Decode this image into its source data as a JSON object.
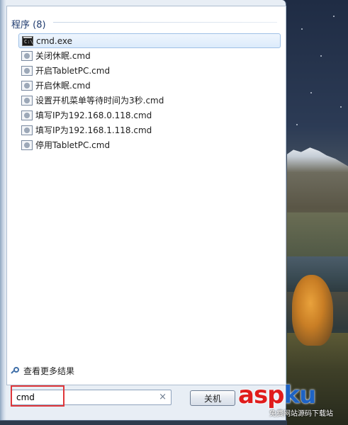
{
  "programs": {
    "header": "程序 (8)",
    "items": [
      {
        "label": "cmd.exe",
        "icon": "cmd-icon",
        "selected": true
      },
      {
        "label": "关闭休眠.cmd",
        "icon": "batch-file-icon"
      },
      {
        "label": "开启TabletPC.cmd",
        "icon": "batch-file-icon"
      },
      {
        "label": "开启休眠.cmd",
        "icon": "batch-file-icon"
      },
      {
        "label": "设置开机菜单等待时间为3秒.cmd",
        "icon": "batch-file-icon"
      },
      {
        "label": "填写IP为192.168.0.118.cmd",
        "icon": "batch-file-icon"
      },
      {
        "label": "填写IP为192.168.1.118.cmd",
        "icon": "batch-file-icon"
      },
      {
        "label": "停用TabletPC.cmd",
        "icon": "batch-file-icon"
      }
    ]
  },
  "more_results": {
    "label": "查看更多结果",
    "icon": "search-icon"
  },
  "search": {
    "value": "cmd",
    "clear_icon": "clear-icon"
  },
  "shutdown": {
    "label": "关机"
  },
  "watermark": {
    "brand_a": "asp",
    "brand_b": "ku",
    "sub": "免费网站源码下载站"
  },
  "colors": {
    "selection_border": "#9ec0e6",
    "highlight_box": "#e0373a",
    "header_text": "#1e3a6e"
  }
}
